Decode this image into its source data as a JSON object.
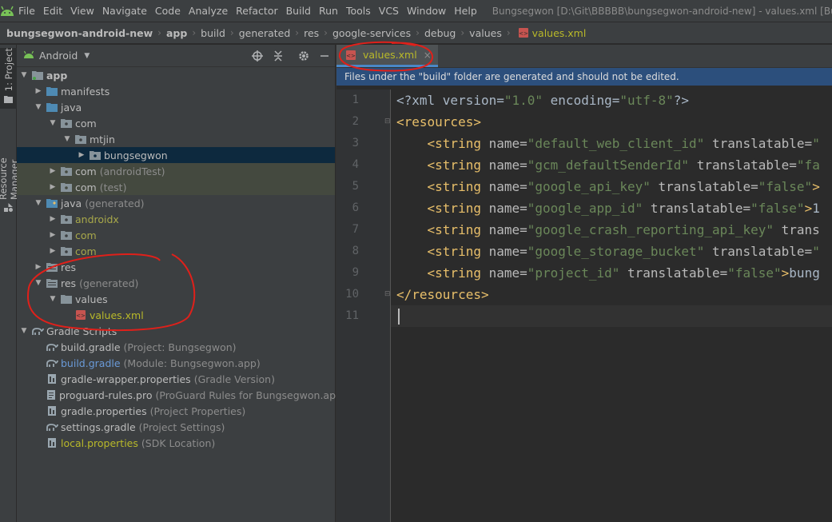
{
  "menu": {
    "items": [
      "File",
      "Edit",
      "View",
      "Navigate",
      "Code",
      "Analyze",
      "Refactor",
      "Build",
      "Run",
      "Tools",
      "VCS",
      "Window",
      "Help"
    ],
    "window_title": "Bungsegwon [D:\\Git\\BBBBB\\bungsegwon-android-new] - values.xml [Bungsegwon"
  },
  "breadcrumb": [
    "bungsegwon-android-new",
    "app",
    "build",
    "generated",
    "res",
    "google-services",
    "debug",
    "values",
    "values.xml"
  ],
  "left_strip": {
    "project_tab": "1: Project",
    "resource_tab": "Resource Manager"
  },
  "project_panel": {
    "view_selector": "Android",
    "tree": [
      {
        "label": "app",
        "hint": "",
        "color": "normal"
      },
      {
        "label": "manifests",
        "hint": "",
        "color": "normal"
      },
      {
        "label": "java",
        "hint": "",
        "color": "normal"
      },
      {
        "label": "com",
        "hint": "",
        "color": "normal"
      },
      {
        "label": "mtjin",
        "hint": "",
        "color": "normal"
      },
      {
        "label": "bungsegwon",
        "hint": "",
        "color": "normal"
      },
      {
        "label": "com",
        "hint": "(androidTest)",
        "color": "normal"
      },
      {
        "label": "com",
        "hint": "(test)",
        "color": "normal"
      },
      {
        "label": "java",
        "hint": "(generated)",
        "color": "normal"
      },
      {
        "label": "androidx",
        "hint": "",
        "color": "olive"
      },
      {
        "label": "com",
        "hint": "",
        "color": "olive"
      },
      {
        "label": "com",
        "hint": "",
        "color": "olive"
      },
      {
        "label": "res",
        "hint": "",
        "color": "normal"
      },
      {
        "label": "res",
        "hint": "(generated)",
        "color": "normal"
      },
      {
        "label": "values",
        "hint": "",
        "color": "normal"
      },
      {
        "label": "values.xml",
        "hint": "",
        "color": "yellow"
      },
      {
        "label": "Gradle Scripts",
        "hint": "",
        "color": "normal"
      },
      {
        "label": "build.gradle",
        "hint": "(Project: Bungsegwon)",
        "color": "normal"
      },
      {
        "label": "build.gradle",
        "hint": "(Module: Bungsegwon.app)",
        "color": "blue"
      },
      {
        "label": "gradle-wrapper.properties",
        "hint": "(Gradle Version)",
        "color": "normal"
      },
      {
        "label": "proguard-rules.pro",
        "hint": "(ProGuard Rules for Bungsegwon.app)",
        "color": "normal"
      },
      {
        "label": "gradle.properties",
        "hint": "(Project Properties)",
        "color": "normal"
      },
      {
        "label": "settings.gradle",
        "hint": "(Project Settings)",
        "color": "normal"
      },
      {
        "label": "local.properties",
        "hint": "(SDK Location)",
        "color": "yellow"
      }
    ]
  },
  "editor": {
    "tab_label": "values.xml",
    "tab_close": "×",
    "banner": "Files under the \"build\" folder are generated and should not be edited.",
    "line_numbers": [
      "1",
      "2",
      "3",
      "4",
      "5",
      "6",
      "7",
      "8",
      "9",
      "10",
      "11"
    ],
    "lines": [
      [
        {
          "t": "<?xml version=",
          "c": "txt"
        },
        {
          "t": "\"1.0\"",
          "c": "val"
        },
        {
          "t": " encoding=",
          "c": "txt"
        },
        {
          "t": "\"utf-8\"",
          "c": "val"
        },
        {
          "t": "?>",
          "c": "txt"
        }
      ],
      [
        {
          "t": "<resources>",
          "c": "tag"
        }
      ],
      [
        {
          "t": "    <string",
          "c": "tag"
        },
        {
          "t": " name=",
          "c": "attr"
        },
        {
          "t": "\"default_web_client_id\"",
          "c": "val"
        },
        {
          "t": " translatable=",
          "c": "attr"
        },
        {
          "t": "\"",
          "c": "val"
        }
      ],
      [
        {
          "t": "    <string",
          "c": "tag"
        },
        {
          "t": " name=",
          "c": "attr"
        },
        {
          "t": "\"gcm_defaultSenderId\"",
          "c": "val"
        },
        {
          "t": " translatable=",
          "c": "attr"
        },
        {
          "t": "\"fa",
          "c": "val"
        }
      ],
      [
        {
          "t": "    <string",
          "c": "tag"
        },
        {
          "t": " name=",
          "c": "attr"
        },
        {
          "t": "\"google_api_key\"",
          "c": "val"
        },
        {
          "t": " translatable=",
          "c": "attr"
        },
        {
          "t": "\"false\"",
          "c": "val"
        },
        {
          "t": ">",
          "c": "tag"
        }
      ],
      [
        {
          "t": "    <string",
          "c": "tag"
        },
        {
          "t": " name=",
          "c": "attr"
        },
        {
          "t": "\"google_app_id\"",
          "c": "val"
        },
        {
          "t": " translatable=",
          "c": "attr"
        },
        {
          "t": "\"false\"",
          "c": "val"
        },
        {
          "t": ">",
          "c": "tag"
        },
        {
          "t": "1",
          "c": "txt"
        }
      ],
      [
        {
          "t": "    <string",
          "c": "tag"
        },
        {
          "t": " name=",
          "c": "attr"
        },
        {
          "t": "\"google_crash_reporting_api_key\"",
          "c": "val"
        },
        {
          "t": " trans",
          "c": "attr"
        }
      ],
      [
        {
          "t": "    <string",
          "c": "tag"
        },
        {
          "t": " name=",
          "c": "attr"
        },
        {
          "t": "\"google_storage_bucket\"",
          "c": "val"
        },
        {
          "t": " translatable=",
          "c": "attr"
        },
        {
          "t": "\"",
          "c": "val"
        }
      ],
      [
        {
          "t": "    <string",
          "c": "tag"
        },
        {
          "t": " name=",
          "c": "attr"
        },
        {
          "t": "\"project_id\"",
          "c": "val"
        },
        {
          "t": " translatable=",
          "c": "attr"
        },
        {
          "t": "\"false\"",
          "c": "val"
        },
        {
          "t": ">",
          "c": "tag"
        },
        {
          "t": "bung",
          "c": "txt"
        }
      ],
      [
        {
          "t": "</resources>",
          "c": "tag"
        }
      ],
      []
    ]
  },
  "colors": {
    "annotation_red": "#e0201a",
    "selection": "#0d293e",
    "highlight": "#44493f",
    "banner": "#2c4f7c"
  }
}
